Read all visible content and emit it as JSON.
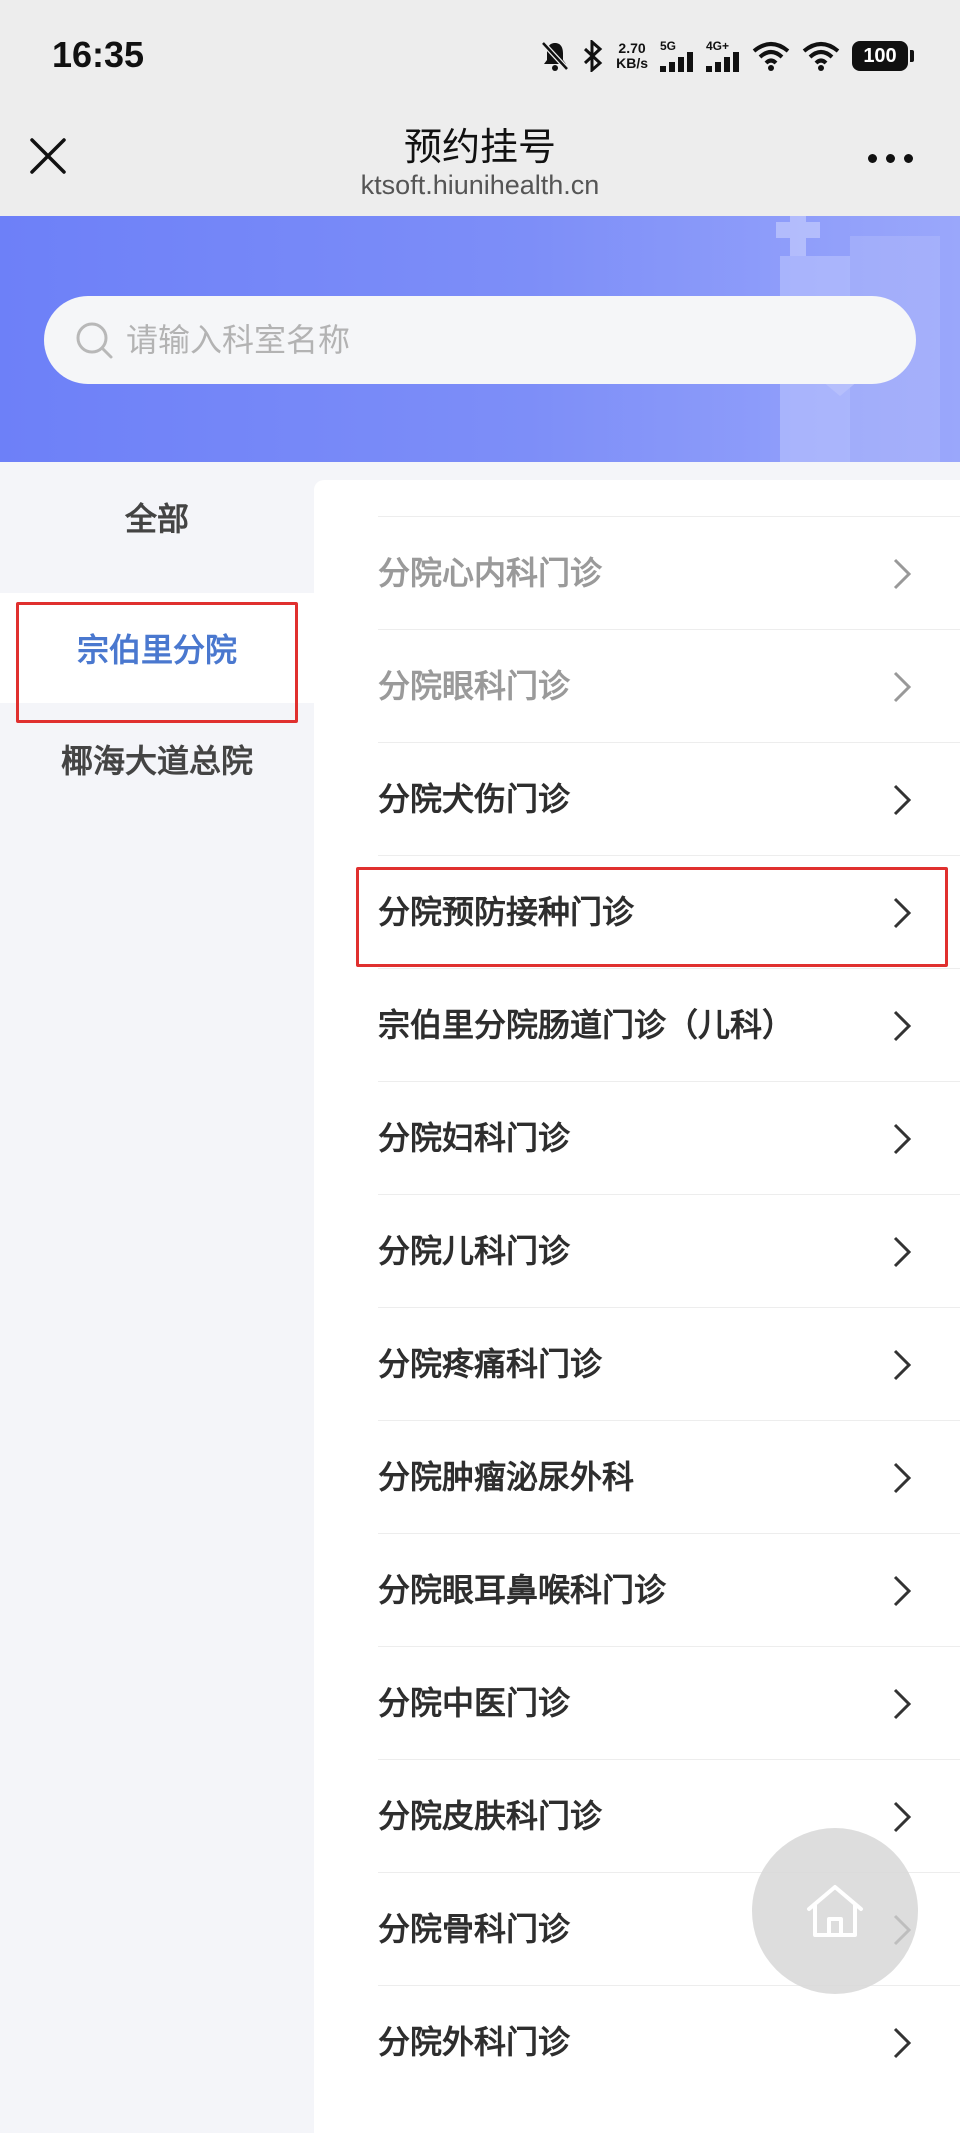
{
  "status_bar": {
    "time": "16:35",
    "net_speed_value": "2.70",
    "net_speed_unit": "KB/s",
    "network_1": "5G",
    "network_2": "4G+",
    "battery": "100"
  },
  "titlebar": {
    "title": "预约挂号",
    "url": "ktsoft.hiunihealth.cn"
  },
  "search": {
    "placeholder": "请输入科室名称"
  },
  "sidebar": {
    "items": [
      {
        "label": "全部"
      },
      {
        "label": "宗伯里分院"
      },
      {
        "label": "椰海大道总院"
      }
    ],
    "active_index": 1
  },
  "departments": [
    {
      "label": "分院心内科门诊"
    },
    {
      "label": "分院眼科门诊"
    },
    {
      "label": "分院犬伤门诊"
    },
    {
      "label": "分院预防接种门诊"
    },
    {
      "label": "宗伯里分院肠道门诊（儿科）"
    },
    {
      "label": "分院妇科门诊"
    },
    {
      "label": "分院儿科门诊"
    },
    {
      "label": "分院疼痛科门诊"
    },
    {
      "label": "分院肿瘤泌尿外科"
    },
    {
      "label": "分院眼耳鼻喉科门诊"
    },
    {
      "label": "分院中医门诊"
    },
    {
      "label": "分院皮肤科门诊"
    },
    {
      "label": "分院骨科门诊"
    },
    {
      "label": "分院外科门诊"
    }
  ],
  "colors": {
    "banner": "#7384f8",
    "active_text": "#4a78cf",
    "highlight_border": "#e0302f"
  },
  "icons": [
    "close-icon",
    "more-icon",
    "search-icon",
    "chevron-right-icon",
    "home-icon"
  ]
}
